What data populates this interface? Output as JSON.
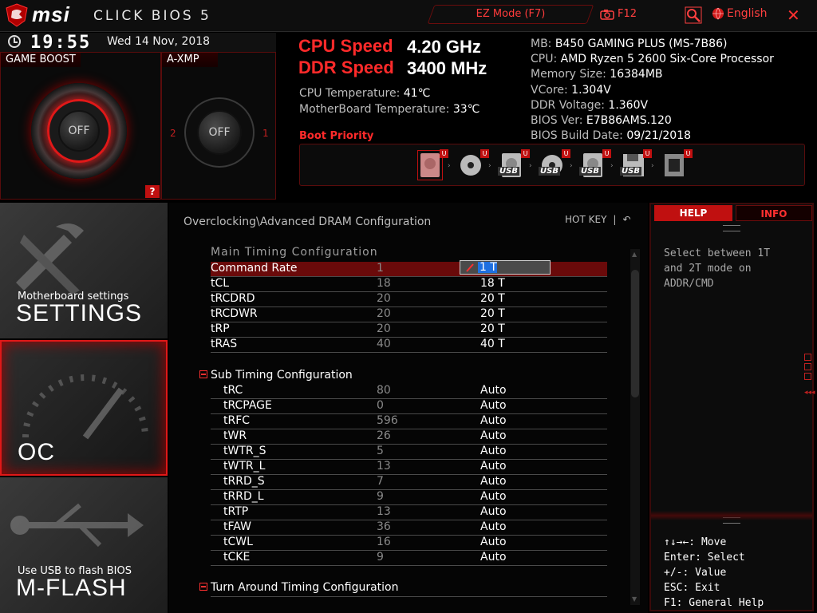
{
  "topbar": {
    "brand": "msi",
    "product": "CLICK BIOS 5",
    "ez_mode": "EZ Mode (F7)",
    "screenshot_key": "F12",
    "language": "English"
  },
  "status": {
    "time": "19:55",
    "date": "Wed  14 Nov, 2018",
    "game_boost_label": "GAME BOOST",
    "game_boost_state": "OFF",
    "axmp_label": "A-XMP",
    "axmp_state": "OFF",
    "axmp_left": "2",
    "axmp_right": "1",
    "help_icon": "?",
    "cpu_speed_label": "CPU Speed",
    "cpu_speed_value": "4.20 GHz",
    "ddr_speed_label": "DDR Speed",
    "ddr_speed_value": "3400 MHz",
    "cpu_temp_label": "CPU Temperature: ",
    "cpu_temp_value": "41℃",
    "mb_temp_label": "MotherBoard Temperature: ",
    "mb_temp_value": "33℃",
    "boot_priority_label": "Boot Priority"
  },
  "sysinfo": [
    {
      "label": "MB: ",
      "value": "B450 GAMING PLUS (MS-7B86)"
    },
    {
      "label": "CPU: ",
      "value": "AMD Ryzen 5 2600 Six-Core Processor"
    },
    {
      "label": "Memory Size: ",
      "value": "16384MB"
    },
    {
      "label": "VCore: ",
      "value": "1.304V"
    },
    {
      "label": "DDR Voltage: ",
      "value": "1.360V"
    },
    {
      "label": "BIOS Ver: ",
      "value": "E7B86AMS.120"
    },
    {
      "label": "BIOS Build Date: ",
      "value": "09/21/2018"
    }
  ],
  "boot_devices": [
    {
      "icon": "hdd-icon",
      "label": "",
      "badge": "U"
    },
    {
      "icon": "optical-disc-icon",
      "label": "",
      "badge": "U"
    },
    {
      "icon": "usb-hdd-icon",
      "label": "USB",
      "badge": "U"
    },
    {
      "icon": "usb-optical-icon",
      "label": "USB",
      "badge": "U"
    },
    {
      "icon": "usb-key-icon",
      "label": "USB",
      "badge": "U"
    },
    {
      "icon": "usb-floppy-icon",
      "label": "USB",
      "badge": "U"
    },
    {
      "icon": "network-icon",
      "label": "",
      "badge": "U"
    }
  ],
  "nav": {
    "settings_sub": "Motherboard settings",
    "settings_title": "SETTINGS",
    "oc_title": "OC",
    "mflash_sub": "Use USB to flash BIOS",
    "mflash_title": "M-FLASH"
  },
  "main": {
    "breadcrumb": "Overclocking\\Advanced DRAM Configuration",
    "hotkey_label": "HOT KEY",
    "hotkey_sep": "|",
    "main_timing_header": "Main  Timing  Configuration",
    "sub_timing_header": "Sub Timing Configuration",
    "turnaround_header": "Turn Around Timing Configuration",
    "main_rows": [
      {
        "name": "Command Rate",
        "current": "1",
        "value": "1 T"
      },
      {
        "name": "tCL",
        "current": "18",
        "value": "18 T"
      },
      {
        "name": "tRCDRD",
        "current": "20",
        "value": "20 T"
      },
      {
        "name": "tRCDWR",
        "current": "20",
        "value": "20 T"
      },
      {
        "name": "tRP",
        "current": "20",
        "value": "20 T"
      },
      {
        "name": "tRAS",
        "current": "40",
        "value": "40 T"
      }
    ],
    "sub_rows": [
      {
        "name": "tRC",
        "current": "80",
        "value": "Auto"
      },
      {
        "name": "tRCPAGE",
        "current": "0",
        "value": "Auto"
      },
      {
        "name": "tRFC",
        "current": "596",
        "value": "Auto"
      },
      {
        "name": "tWR",
        "current": "26",
        "value": "Auto"
      },
      {
        "name": "tWTR_S",
        "current": "5",
        "value": "Auto"
      },
      {
        "name": "tWTR_L",
        "current": "13",
        "value": "Auto"
      },
      {
        "name": "tRRD_S",
        "current": "7",
        "value": "Auto"
      },
      {
        "name": "tRRD_L",
        "current": "9",
        "value": "Auto"
      },
      {
        "name": "tRTP",
        "current": "13",
        "value": "Auto"
      },
      {
        "name": "tFAW",
        "current": "36",
        "value": "Auto"
      },
      {
        "name": "tCWL",
        "current": "16",
        "value": "Auto"
      },
      {
        "name": "tCKE",
        "current": "9",
        "value": "Auto"
      }
    ]
  },
  "help": {
    "tab_help": "HELP",
    "tab_info": "INFO",
    "text": "Select between 1T and 2T mode on ADDR/CMD",
    "keys": [
      "↑↓→←: Move",
      "Enter: Select",
      "+/-: Value",
      "ESC: Exit",
      "F1: General Help"
    ]
  },
  "colors": {
    "accent": "#ff2a2a",
    "selected_row": "#6a0a0a",
    "background": "#000000"
  }
}
